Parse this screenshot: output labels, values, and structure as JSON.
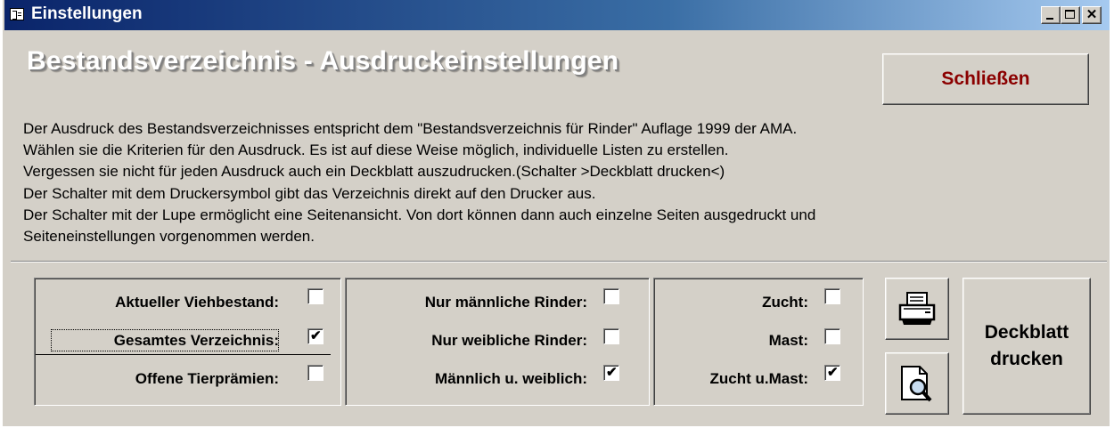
{
  "window": {
    "title": "Einstellungen"
  },
  "header": {
    "title": "Bestandsverzeichnis - Ausdruckeinstellungen",
    "close_label": "Schließen"
  },
  "description": {
    "lines": [
      "Der Ausdruck des Bestandsverzeichnisses entspricht dem \"Bestandsverzeichnis für Rinder\" Auflage 1999 der AMA.",
      "Wählen sie die Kriterien für den Ausdruck. Es ist auf diese Weise möglich, individuelle Listen zu erstellen.",
      "Vergessen sie nicht für jeden Ausdruck auch ein Deckblatt auszudrucken.(Schalter >Deckblatt drucken<)",
      "Der Schalter mit dem Druckersymbol gibt das Verzeichnis direkt auf den Drucker aus.",
      "Der Schalter mit der Lupe ermöglicht eine Seitenansicht. Von dort können dann auch einzelne Seiten ausgedruckt und",
      "Seiteneinstellungen vorgenommen werden."
    ]
  },
  "groups": {
    "bestand": {
      "options": [
        {
          "label": "Aktueller Viehbestand:",
          "checked": false
        },
        {
          "label": "Gesamtes Verzeichnis:",
          "checked": true
        },
        {
          "label": "Offene Tierprämien:",
          "checked": false
        }
      ]
    },
    "geschlecht": {
      "options": [
        {
          "label": "Nur männliche Rinder:",
          "checked": false
        },
        {
          "label": "Nur weibliche Rinder:",
          "checked": false
        },
        {
          "label": "Männlich u. weiblich:",
          "checked": true
        }
      ]
    },
    "nutzung": {
      "options": [
        {
          "label": "Zucht:",
          "checked": false
        },
        {
          "label": "Mast:",
          "checked": false
        },
        {
          "label": "Zucht u.Mast:",
          "checked": true
        }
      ]
    }
  },
  "buttons": {
    "print_icon": "printer-icon",
    "preview_icon": "magnifier-page-icon",
    "deckblatt_line1": "Deckblatt",
    "deckblatt_line2": "drucken"
  }
}
